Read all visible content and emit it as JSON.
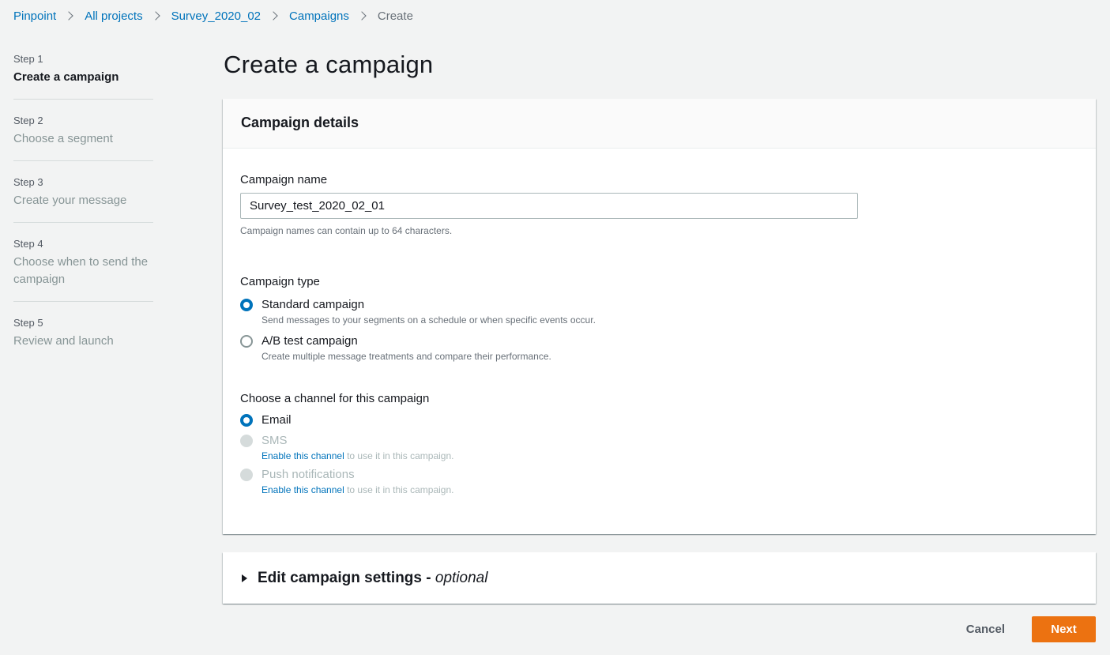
{
  "breadcrumb": [
    {
      "label": "Pinpoint"
    },
    {
      "label": "All projects"
    },
    {
      "label": "Survey_2020_02"
    },
    {
      "label": "Campaigns"
    },
    {
      "label": "Create"
    }
  ],
  "steps": [
    {
      "number": "Step 1",
      "title": "Create a campaign"
    },
    {
      "number": "Step 2",
      "title": "Choose a segment"
    },
    {
      "number": "Step 3",
      "title": "Create your message"
    },
    {
      "number": "Step 4",
      "title": "Choose when to send the campaign"
    },
    {
      "number": "Step 5",
      "title": "Review and launch"
    }
  ],
  "page_title": "Create a campaign",
  "details": {
    "header": "Campaign details",
    "name_label": "Campaign name",
    "name_value": "Survey_test_2020_02_01",
    "name_hint": "Campaign names can contain up to 64 characters.",
    "type_label": "Campaign type",
    "types": [
      {
        "label": "Standard campaign",
        "desc": "Send messages to your segments on a schedule or when specific events occur."
      },
      {
        "label": "A/B test campaign",
        "desc": "Create multiple message treatments and compare their performance."
      }
    ],
    "channel_label": "Choose a channel for this campaign",
    "channels": [
      {
        "label": "Email"
      },
      {
        "label": "SMS",
        "link": "Enable this channel",
        "suffix": " to use it in this campaign."
      },
      {
        "label": "Push notifications",
        "link": "Enable this channel",
        "suffix": " to use it in this campaign."
      }
    ]
  },
  "settings": {
    "title": "Edit campaign settings - ",
    "optional": "optional"
  },
  "actions": {
    "cancel": "Cancel",
    "next": "Next"
  },
  "colors": {
    "accent": "#0073bb",
    "primary_button": "#ec7211",
    "background": "#f2f3f3"
  }
}
